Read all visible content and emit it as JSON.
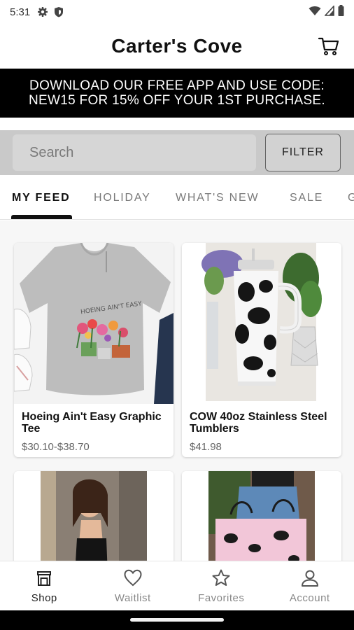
{
  "status_bar": {
    "time": "5:31",
    "left_icons": [
      "gear-icon",
      "shield-icon"
    ],
    "right_icons": [
      "wifi-icon",
      "signal-icon",
      "battery-icon"
    ]
  },
  "header": {
    "title": "Carter's Cove",
    "cart_icon": "cart-icon"
  },
  "banner": {
    "line1": "DOWNLOAD OUR FREE APP AND USE CODE:",
    "line2": "NEW15 FOR 15% OFF YOUR 1ST PURCHASE."
  },
  "search": {
    "placeholder": "Search",
    "filter_label": "FILTER"
  },
  "tabs": [
    {
      "label": "MY FEED",
      "active": true
    },
    {
      "label": "HOLIDAY",
      "active": false
    },
    {
      "label": "WHAT'S NEW",
      "active": false
    },
    {
      "label": "SALE",
      "active": false
    },
    {
      "label": "G",
      "active": false
    }
  ],
  "products": [
    {
      "name": "Hoeing Ain't Easy Graphic Tee",
      "price": "$30.10-$38.70",
      "shirt_text": "HOEING AIN'T EASY"
    },
    {
      "name": "COW 40oz Stainless Steel Tumblers",
      "price": "$41.98"
    },
    {
      "name": "",
      "price": ""
    },
    {
      "name": "",
      "price": ""
    }
  ],
  "bottom_nav": [
    {
      "label": "Shop",
      "icon": "shop-icon",
      "active": true
    },
    {
      "label": "Waitlist",
      "icon": "heart-icon",
      "active": false
    },
    {
      "label": "Favorites",
      "icon": "star-icon",
      "active": false
    },
    {
      "label": "Account",
      "icon": "account-icon",
      "active": false
    }
  ],
  "colors": {
    "banner_bg": "#000000",
    "search_bar_bg": "#c9c9c9",
    "active_tab": "#111111",
    "inactive_tab": "#7a7a7a"
  }
}
